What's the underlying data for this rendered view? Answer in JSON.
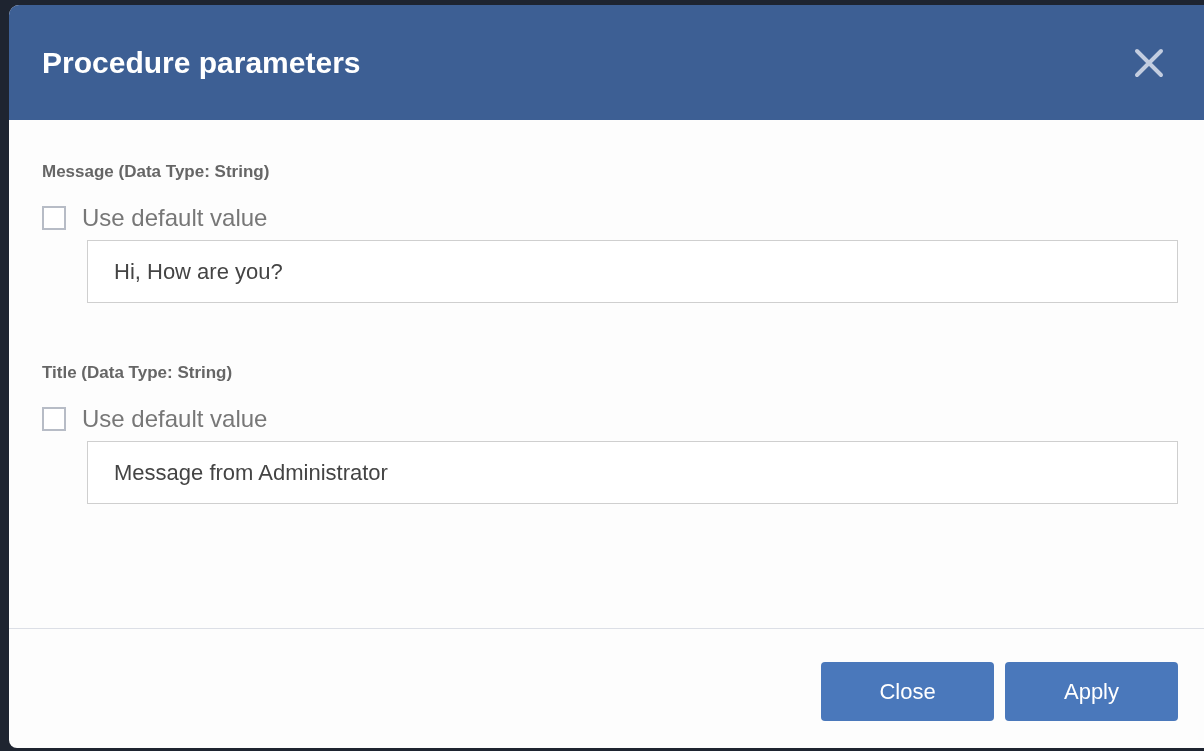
{
  "dialog": {
    "title": "Procedure parameters"
  },
  "parameters": [
    {
      "label": "Message (Data Type: String)",
      "use_default": {
        "label": "Use default value",
        "checked": false
      },
      "value": "Hi, How are you?"
    },
    {
      "label": "Title (Data Type: String)",
      "use_default": {
        "label": "Use default value",
        "checked": false
      },
      "value": "Message from Administrator"
    }
  ],
  "buttons": [
    "Close",
    "Apply"
  ]
}
